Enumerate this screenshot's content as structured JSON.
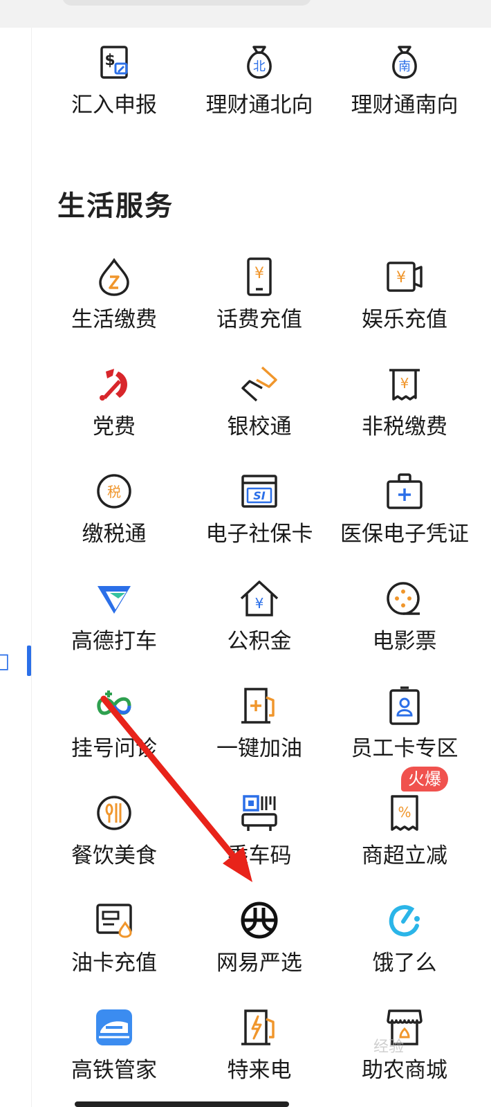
{
  "section_title": "生活服务",
  "top_row": [
    {
      "label": "汇入申报",
      "icon": "remittance-declare-icon"
    },
    {
      "label": "理财通北向",
      "icon": "northbound-money-bag-icon",
      "glyph": "北"
    },
    {
      "label": "理财通南向",
      "icon": "southbound-money-bag-icon",
      "glyph": "南"
    }
  ],
  "services": [
    {
      "label": "生活缴费",
      "icon": "utility-drop-icon"
    },
    {
      "label": "话费充值",
      "icon": "phone-topup-icon"
    },
    {
      "label": "娱乐充值",
      "icon": "entertainment-topup-icon"
    },
    {
      "label": "党费",
      "icon": "party-emblem-icon"
    },
    {
      "label": "银校通",
      "icon": "bank-school-icon"
    },
    {
      "label": "非税缴费",
      "icon": "receipt-icon"
    },
    {
      "label": "缴税通",
      "icon": "tax-coin-icon",
      "glyph": "税"
    },
    {
      "label": "电子社保卡",
      "icon": "social-security-card-icon",
      "glyph": "SI"
    },
    {
      "label": "医保电子凭证",
      "icon": "medical-kit-icon"
    },
    {
      "label": "高德打车",
      "icon": "amap-taxi-icon"
    },
    {
      "label": "公积金",
      "icon": "housing-fund-icon"
    },
    {
      "label": "电影票",
      "icon": "movie-reel-icon"
    },
    {
      "label": "挂号问诊",
      "icon": "hospital-register-icon"
    },
    {
      "label": "一键加油",
      "icon": "fuel-pump-icon"
    },
    {
      "label": "员工卡专区",
      "icon": "employee-badge-icon"
    },
    {
      "label": "餐饮美食",
      "icon": "dining-icon"
    },
    {
      "label": "乘车码",
      "icon": "bus-qr-icon"
    },
    {
      "label": "商超立减",
      "icon": "discount-receipt-icon"
    },
    {
      "label": "油卡充值",
      "icon": "fuel-card-icon"
    },
    {
      "label": "网易严选",
      "icon": "netease-yanxuan-icon"
    },
    {
      "label": "饿了么",
      "icon": "eleme-icon"
    },
    {
      "label": "高铁管家",
      "icon": "high-speed-rail-icon"
    },
    {
      "label": "特来电",
      "icon": "ev-charging-icon"
    },
    {
      "label": "助农商城",
      "icon": "farm-store-icon"
    }
  ],
  "badge": "火爆",
  "watermark": "经验",
  "colors": {
    "blue": "#2b6fe8",
    "orange": "#f0962c",
    "red": "#d8262b",
    "badge": "#f0524e",
    "arrow": "#e8231a"
  }
}
